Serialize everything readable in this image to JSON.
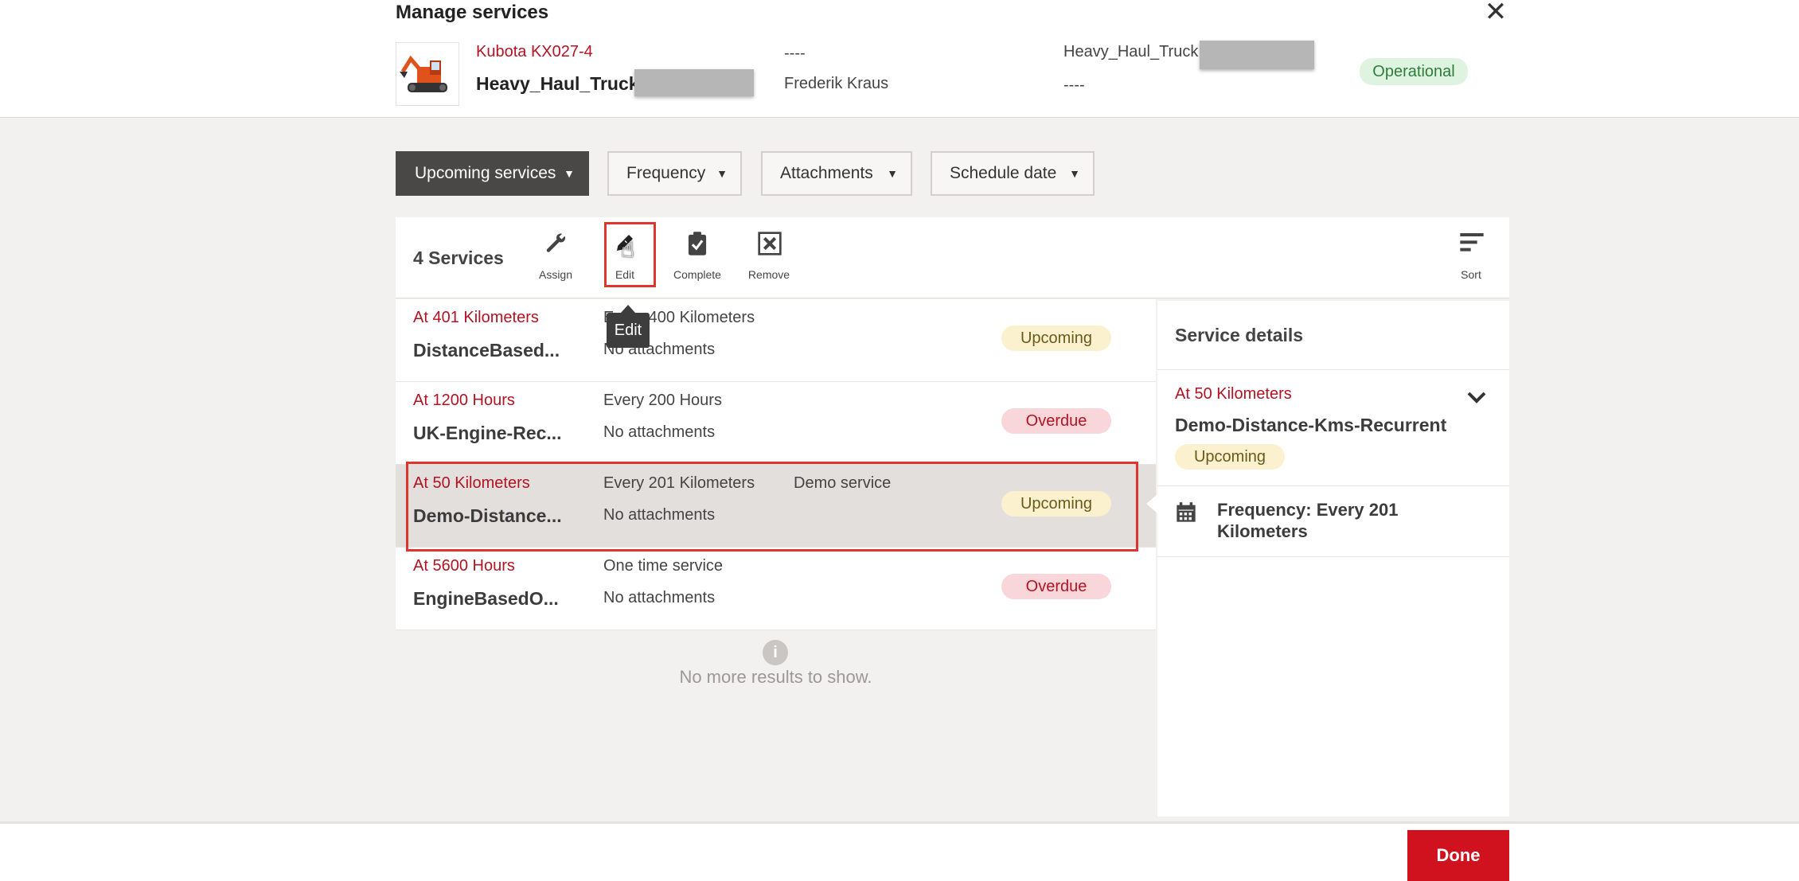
{
  "header": {
    "title": "Manage services",
    "machine_model": "Kubota KX027-4",
    "machine_name": "Heavy_Haul_Truck",
    "field_1": "----",
    "operator": "Frederik Kraus",
    "group_name": "Heavy_Haul_Truck",
    "field_2": "----",
    "status": "Operational"
  },
  "filters": [
    {
      "label": "Upcoming services"
    },
    {
      "label": "Frequency"
    },
    {
      "label": "Attachments"
    },
    {
      "label": "Schedule date"
    }
  ],
  "toolbar": {
    "count": "4 Services",
    "assign": "Assign",
    "edit": "Edit",
    "complete": "Complete",
    "remove": "Remove",
    "sort": "Sort",
    "tooltip": "Edit"
  },
  "services": [
    {
      "trigger": "At 401 Kilometers",
      "name": "DistanceBased...",
      "frequency": "Every 400 Kilometers",
      "attachments": "No attachments",
      "description": "",
      "status": "Upcoming"
    },
    {
      "trigger": "At 1200 Hours",
      "name": "UK-Engine-Rec...",
      "frequency": "Every 200 Hours",
      "attachments": "No attachments",
      "description": "",
      "status": "Overdue"
    },
    {
      "trigger": "At 50 Kilometers",
      "name": "Demo-Distance...",
      "frequency": "Every 201 Kilometers",
      "attachments": "No attachments",
      "description": "Demo service",
      "status": "Upcoming"
    },
    {
      "trigger": "At 5600 Hours",
      "name": "EngineBasedO...",
      "frequency": "One time service",
      "attachments": "No attachments",
      "description": "",
      "status": "Overdue"
    }
  ],
  "no_more": "No more results to show.",
  "details": {
    "title": "Service details",
    "trigger": "At 50 Kilometers",
    "name": "Demo-Distance-Kms-Recurrent",
    "status": "Upcoming",
    "frequency_line1": "Frequency: Every 201",
    "frequency_line2": "Kilometers"
  },
  "footer": {
    "done": "Done"
  },
  "colors": {
    "accent": "#d0121f",
    "upcoming_bg": "#fbf1cf",
    "overdue_bg": "#f8d6d9",
    "operational_bg": "#dff3e1"
  }
}
